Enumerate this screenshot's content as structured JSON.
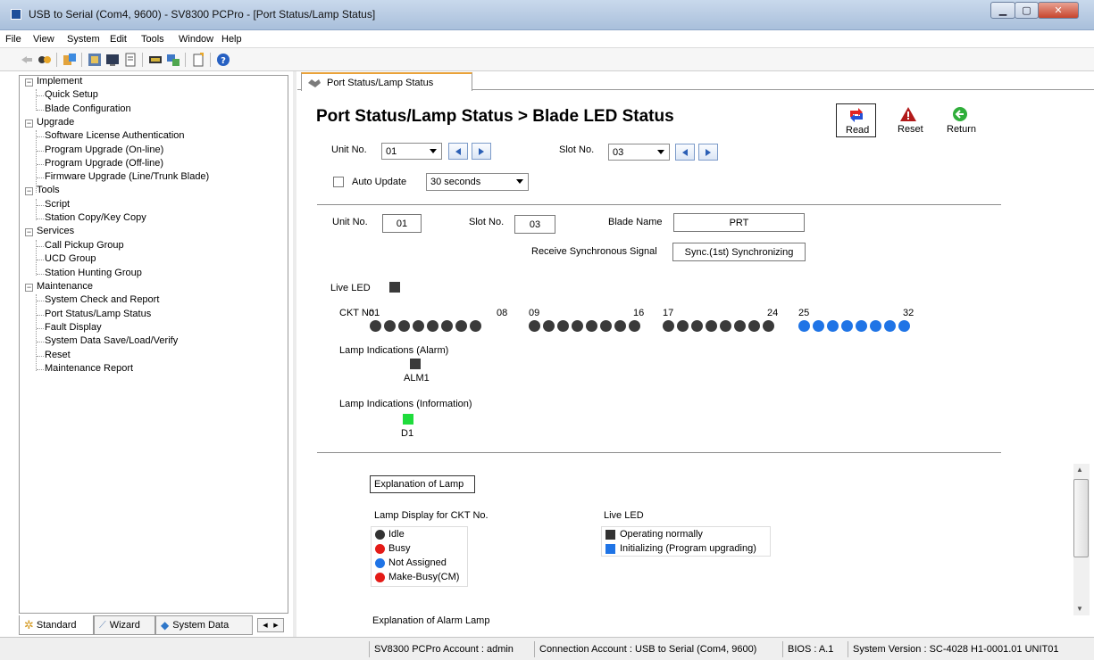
{
  "window": {
    "title": "USB to Serial (Com4, 9600) - SV8300 PCPro - [Port Status/Lamp Status]",
    "min_glyph": "▁",
    "max_glyph": "▢",
    "close_glyph": "✕"
  },
  "menu": [
    "File",
    "View",
    "System",
    "Edit",
    "Tools",
    "Window",
    "Help"
  ],
  "toolbar_icons": [
    "back-arrow-icon",
    "connect-icon",
    "system-icon",
    "blade-icon",
    "terminal-icon",
    "document-icon",
    "card-icon",
    "network-icon",
    "new-file-icon",
    "help-icon"
  ],
  "tree": {
    "groups": [
      {
        "label": "Implement",
        "items": [
          "Quick Setup",
          "Blade Configuration"
        ]
      },
      {
        "label": "Upgrade",
        "items": [
          "Software License Authentication",
          "Program Upgrade (On-line)",
          "Program Upgrade (Off-line)",
          "Firmware Upgrade (Line/Trunk Blade)"
        ]
      },
      {
        "label": "Tools",
        "items": [
          "Script",
          "Station Copy/Key Copy"
        ]
      },
      {
        "label": "Services",
        "items": [
          "Call Pickup Group",
          "UCD Group",
          "Station Hunting Group"
        ]
      },
      {
        "label": "Maintenance",
        "items": [
          "System Check and Report",
          "Port Status/Lamp Status",
          "Fault Display",
          "System Data Save/Load/Verify",
          "Reset",
          "Maintenance Report"
        ]
      }
    ],
    "toggle_glyph": "−"
  },
  "bottom_tabs": [
    "Standard",
    "Wizard",
    "System Data"
  ],
  "doc_tab": "Port Status/Lamp Status",
  "page": {
    "heading": "Port Status/Lamp Status > Blade LED Status",
    "actions": {
      "read": "Read",
      "reset": "Reset",
      "return": "Return"
    },
    "unit_label": "Unit No.",
    "unit_value": "01",
    "slot_label": "Slot No.",
    "slot_value": "03",
    "auto_update_label": "Auto Update",
    "auto_update_checked": false,
    "interval": "30 seconds",
    "info": {
      "unit_label": "Unit No.",
      "unit_value": "01",
      "slot_label": "Slot No.",
      "slot_value": "03",
      "blade_label": "Blade Name",
      "blade_value": "PRT",
      "sync_label": "Receive Synchronous Signal",
      "sync_value": "Sync.(1st) Synchronizing"
    },
    "live_led_label": "Live LED",
    "ckt_label": "CKT No.",
    "ckt_groups": [
      {
        "start": "01",
        "end": "08",
        "color": "#3a3a3a"
      },
      {
        "start": "09",
        "end": "16",
        "color": "#3a3a3a"
      },
      {
        "start": "17",
        "end": "24",
        "color": "#3a3a3a"
      },
      {
        "start": "25",
        "end": "32",
        "color": "#1f74e6"
      }
    ],
    "alarm_label": "Lamp Indications (Alarm)",
    "alarm_lamp": "ALM1",
    "info_label": "Lamp Indications (Information)",
    "info_lamp": "D1"
  },
  "explanation": {
    "title": "Explanation of Lamp",
    "ckt_header": "Lamp Display for CKT No.",
    "ckt_items": [
      {
        "label": "Idle",
        "color": "#333333"
      },
      {
        "label": "Busy",
        "color": "#e41b17"
      },
      {
        "label": "Not Assigned",
        "color": "#1f74e6"
      },
      {
        "label": "Make-Busy(CM)",
        "color": "#e41b17"
      }
    ],
    "live_header": "Live LED",
    "live_items": [
      {
        "label": "Operating normally",
        "color": "#333333"
      },
      {
        "label": "Initializing (Program upgrading)",
        "color": "#1f74e6"
      }
    ],
    "alarm_title": "Explanation of Alarm Lamp"
  },
  "status": {
    "account": "SV8300 PCPro Account : admin",
    "connection": "Connection Account : USB to Serial (Com4, 9600)",
    "bios": "BIOS : A.1",
    "version": "System Version : SC-4028 H1-0001.01 UNIT01"
  }
}
